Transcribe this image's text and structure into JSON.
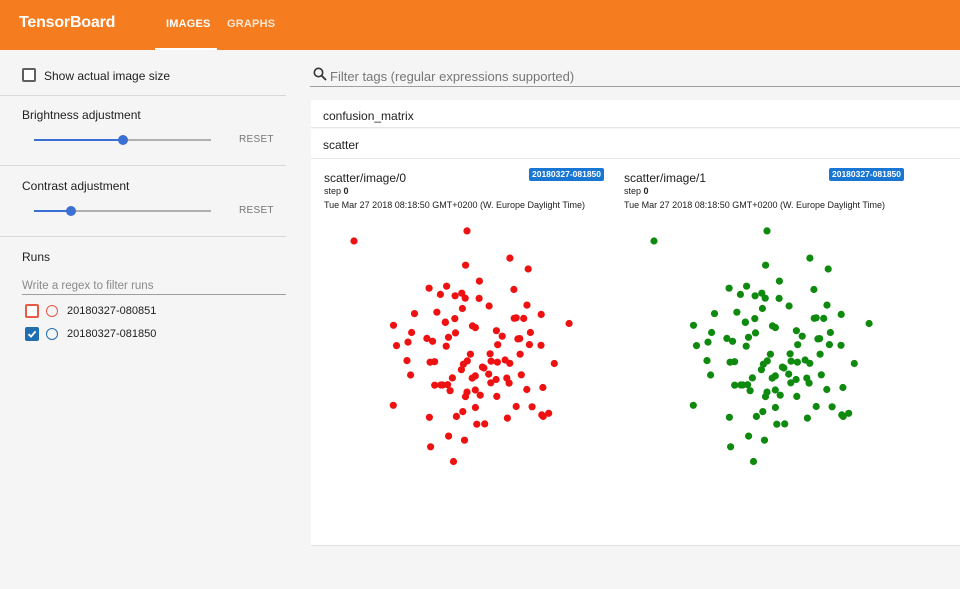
{
  "app": {
    "brand": "TensorBoard",
    "tabs": [
      {
        "label": "IMAGES",
        "active": true
      },
      {
        "label": "GRAPHS",
        "active": false
      }
    ],
    "accent_color": "#f57c1f"
  },
  "sidebar": {
    "show_actual_size_label": "Show actual image size",
    "show_actual_size_checked": false,
    "brightness": {
      "label": "Brightness adjustment",
      "value": 0.5,
      "reset_label": "RESET"
    },
    "contrast": {
      "label": "Contrast adjustment",
      "value": 0.2,
      "reset_label": "RESET"
    },
    "runs": {
      "title": "Runs",
      "filter_placeholder": "Write a regex to filter runs",
      "items": [
        {
          "name": "20180327-080851",
          "checked": false,
          "color": "#e55b45"
        },
        {
          "name": "20180327-081850",
          "checked": true,
          "color": "#1f6fb0"
        }
      ]
    }
  },
  "main": {
    "search_placeholder": "Filter tags (regular expressions supported)",
    "panes": [
      {
        "title": "confusion_matrix"
      },
      {
        "title": "scatter"
      }
    ],
    "cards": [
      {
        "title": "scatter/image/0",
        "run_badge": "20180327-081850",
        "step_label": "step",
        "step_value": "0",
        "timestamp": "Tue Mar 27 2018 08:18:50 GMT+0200 (W. Europe Daylight Time)",
        "point_color": "#ee1111"
      },
      {
        "title": "scatter/image/1",
        "run_badge": "20180327-081850",
        "step_label": "step",
        "step_value": "0",
        "timestamp": "Tue Mar 27 2018 08:18:50 GMT+0200 (W. Europe Daylight Time)",
        "point_color": "#0f8a0f"
      }
    ]
  }
}
